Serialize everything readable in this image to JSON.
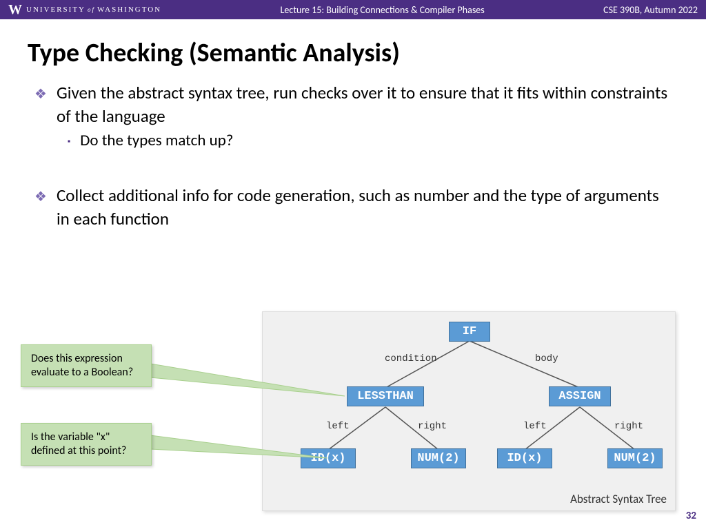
{
  "header": {
    "uw_logo": "W",
    "uw_text1": "UNIVERSITY",
    "uw_of": "of",
    "uw_text2": "WASHINGTON",
    "lecture": "Lecture 15: Building Connections & Compiler Phases",
    "course": "CSE 390B, Autumn 2022"
  },
  "title": "Type Checking (Semantic Analysis)",
  "bullets": {
    "b1": "Given the abstract syntax tree, run checks over it to ensure that it fits within constraints of the language",
    "b1a": "Do the types match up?",
    "b2": "Collect additional info for code generation, such as number and the type of arguments in each function"
  },
  "callouts": {
    "c1": "Does this expression evaluate to a Boolean?",
    "c2": "Is the variable \"x\" defined at this point?"
  },
  "diagram": {
    "caption": "Abstract Syntax Tree",
    "nodes": {
      "if": "IF",
      "lessthan": "LESSTHAN",
      "assign": "ASSIGN",
      "idx1": "ID(x)",
      "num1": "NUM(2)",
      "idx2": "ID(x)",
      "num2": "NUM(2)"
    },
    "edges": {
      "condition": "condition",
      "body": "body",
      "left1": "left",
      "right1": "right",
      "left2": "left",
      "right2": "right"
    }
  },
  "page": "32"
}
